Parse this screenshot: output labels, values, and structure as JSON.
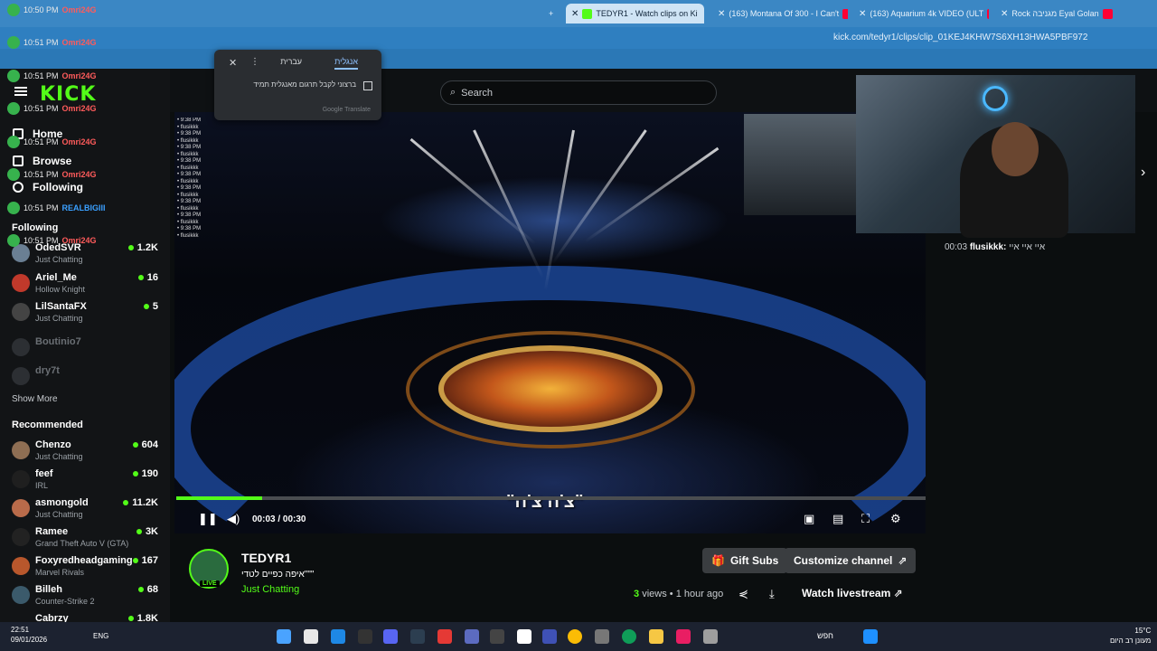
{
  "browser": {
    "tabs": [
      {
        "title": "TEDYR1 - Watch clips on Ki",
        "active": true
      },
      {
        "title": "(163) Montana Of 300 - I Can't",
        "active": false
      },
      {
        "title": "(163) Aquarium 4k VIDEO (ULT",
        "active": false
      },
      {
        "title": "Rock מגניבה Eyal Golan",
        "active": false
      }
    ],
    "url": "kick.com/tedyr1/clips/clip_01KEJ4KHW7S6XH13HWA5PBF972"
  },
  "translate_popup": {
    "tab_english": "אנגלית",
    "tab_hebrew": "עברית",
    "checkbox_label": "ברצוני לקבל תרגום מאנגלית תמיד",
    "footer": "Google Translate"
  },
  "kick": {
    "logo": "KICK",
    "search_placeholder": "Search",
    "nav": {
      "home": "Home",
      "browse": "Browse",
      "following": "Following"
    },
    "following_header": "Following",
    "following": [
      {
        "name": "OdedSVR",
        "category": "Just Chatting",
        "viewers": "1.2K",
        "live": true
      },
      {
        "name": "Ariel_Me",
        "category": "Hollow Knight",
        "viewers": "16",
        "live": true
      },
      {
        "name": "LilSantaFX",
        "category": "Just Chatting",
        "viewers": "5",
        "live": true
      },
      {
        "name": "Boutinio7",
        "category": "",
        "viewers": "",
        "live": false
      },
      {
        "name": "dry7t",
        "category": "",
        "viewers": "",
        "live": false
      }
    ],
    "show_more": "Show More",
    "recommended_header": "Recommended",
    "recommended": [
      {
        "name": "Chenzo",
        "category": "Just Chatting",
        "viewers": "604"
      },
      {
        "name": "feef",
        "category": "IRL",
        "viewers": "190"
      },
      {
        "name": "asmongold",
        "category": "Just Chatting",
        "viewers": "11.2K"
      },
      {
        "name": "Ramee",
        "category": "Grand Theft Auto V (GTA)",
        "viewers": "3K"
      },
      {
        "name": "Foxyredheadgaming",
        "category": "Marvel Rivals",
        "viewers": "167"
      },
      {
        "name": "Billeh",
        "category": "Counter-Strike 2",
        "viewers": "68"
      },
      {
        "name": "Cabrzy",
        "category": "",
        "viewers": "1.8K"
      }
    ]
  },
  "player": {
    "subtitle": "\"צ'ה צ'ה\"",
    "current_time": "00:03",
    "separator": "/",
    "duration": "00:30",
    "progress": 0.115
  },
  "channel": {
    "name": "TEDYR1",
    "clip_title": "איפה כפיים לטדי\"\"\"",
    "category": "Just Chatting",
    "live_badge": "LIVE"
  },
  "actions": {
    "gift_subs": "Gift Subs",
    "customize": "Customize channel",
    "views_count": "3",
    "views_label": "views",
    "dot": "•",
    "time_ago": "1 hour ago",
    "watch_livestream": "Watch livestream"
  },
  "chat": {
    "time": "00:03",
    "user": "flusikkk:",
    "message": "איי איי איי"
  },
  "floating_chat": [
    {
      "time": "10:50 PM",
      "user": "Omri24G"
    },
    {
      "time": "10:51 PM",
      "user": "Omri24G"
    },
    {
      "time": "10:51 PM",
      "user": "Omri24G"
    },
    {
      "time": "10:51 PM",
      "user": "Omri24G"
    },
    {
      "time": "10:51 PM",
      "user": "Omri24G"
    },
    {
      "time": "10:51 PM",
      "user": "Omri24G"
    },
    {
      "time": "10:51 PM",
      "user": "REALBIGIII"
    },
    {
      "time": "10:51 PM",
      "user": "Omri24G"
    }
  ],
  "taskbar": {
    "time": "22:51",
    "date": "09/01/2026",
    "lang": "ENG",
    "search": "חפש",
    "temp": "15°C",
    "weather": "מעונן רב היום"
  },
  "colors": {
    "kick_green": "#53fc18",
    "chrome_blue": "#3b87c4"
  }
}
